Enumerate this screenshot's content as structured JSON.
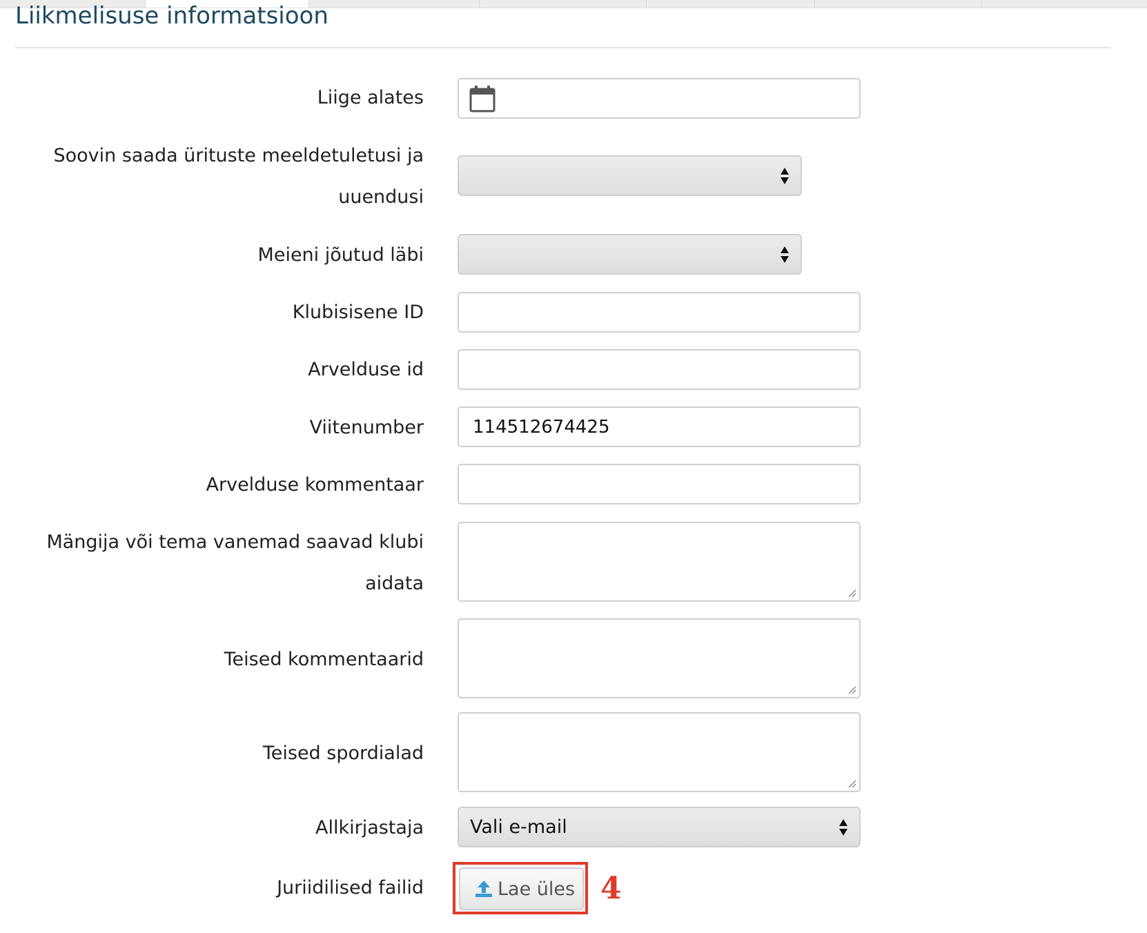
{
  "section": {
    "title": "Liikmelisuse informatsioon"
  },
  "fields": {
    "member_since": {
      "label": "Liige alates",
      "value": ""
    },
    "reminders": {
      "label_line1": "Soovin saada ürituste meeldetuletusi ja",
      "label_line2": "uuendusi",
      "selected": ""
    },
    "referral": {
      "label": "Meieni jõutud läbi",
      "selected": ""
    },
    "club_id": {
      "label": "Klubisisene ID",
      "value": ""
    },
    "billing_id": {
      "label": "Arvelduse id",
      "value": ""
    },
    "reference_number": {
      "label": "Viitenumber",
      "value": "114512674425"
    },
    "billing_comment": {
      "label": "Arvelduse kommentaar",
      "value": ""
    },
    "club_help": {
      "label_line1": "Mängija või tema vanemad saavad klubi",
      "label_line2": "aidata",
      "value": ""
    },
    "other_comments": {
      "label": "Teised kommentaarid",
      "value": ""
    },
    "other_sports": {
      "label": "Teised spordialad",
      "value": ""
    },
    "signer": {
      "label": "Allkirjastaja",
      "selected": "Vali e-mail"
    },
    "legal_files": {
      "label": "Juriidilised failid",
      "button_label": "Lae üles"
    }
  },
  "annotation": {
    "step_number": "4",
    "color": "#e03a2a"
  },
  "icons": {
    "calendar": "calendar-icon",
    "upload": "upload-icon",
    "select_arrows": "select-arrows-icon",
    "resize": "resize-grip-icon"
  },
  "colors": {
    "title": "#1e4a5e",
    "upload_icon": "#3a9bd5"
  }
}
